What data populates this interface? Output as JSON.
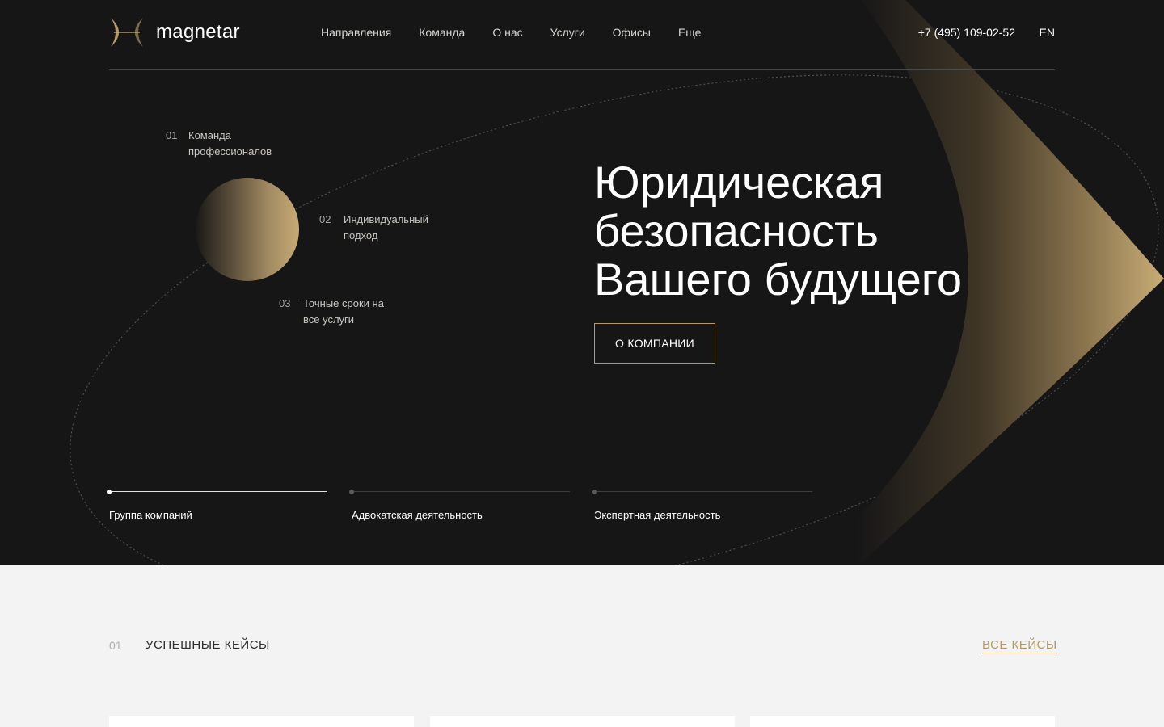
{
  "header": {
    "logo_text": "magnetar",
    "nav": [
      "Направления",
      "Команда",
      "О нас",
      "Услуги",
      "Офисы",
      "Еще"
    ],
    "phone": "+7 (495) 109-02-52",
    "lang": "EN"
  },
  "hero": {
    "features": [
      {
        "num": "01",
        "text": "Команда профессионалов"
      },
      {
        "num": "02",
        "text": "Индивидуальный подход"
      },
      {
        "num": "03",
        "text": "Точные сроки на все услуги"
      }
    ],
    "title_lines": [
      "Юридическая",
      "безопасность",
      "Вашего будущего"
    ],
    "cta_label": "О КОМПАНИИ",
    "tabs": [
      {
        "label": "Группа компаний",
        "active": true
      },
      {
        "label": "Адвокатская деятельность",
        "active": false
      },
      {
        "label": "Экспертная деятельность",
        "active": false
      }
    ]
  },
  "cases": {
    "num": "01",
    "title": "УСПЕШНЫЕ КЕЙСЫ",
    "all_label": "ВСЕ КЕЙСЫ"
  },
  "colors": {
    "background": "#171617",
    "accent": "#b59a66",
    "light_section": "#f3f3f3"
  }
}
